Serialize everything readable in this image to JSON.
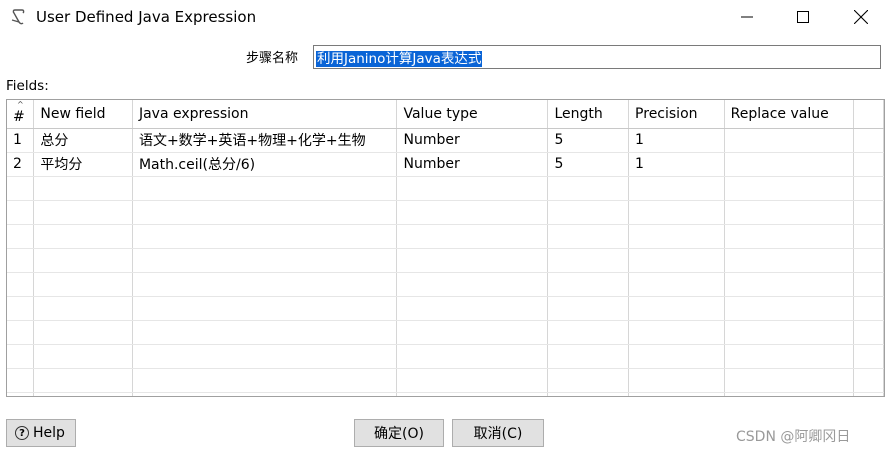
{
  "window": {
    "title": "User Defined Java Expression",
    "minimize_icon": "minimize-icon",
    "maximize_icon": "maximize-icon",
    "close_icon": "close-icon"
  },
  "step": {
    "label": "步骤名称",
    "value": "利用Janino计算Java表达式"
  },
  "fields_label": "Fields:",
  "table": {
    "columns": [
      "#",
      "New field",
      "Java expression",
      "Value type",
      "Length",
      "Precision",
      "Replace value"
    ],
    "rows": [
      [
        "1",
        "总分",
        "语文+数学+英语+物理+化学+生物",
        "Number",
        "5",
        "1",
        ""
      ],
      [
        "2",
        "平均分",
        "Math.ceil(总分/6)",
        "Number",
        "5",
        "1",
        ""
      ]
    ]
  },
  "buttons": {
    "help": "Help",
    "ok": "确定(O)",
    "cancel": "取消(C)"
  },
  "watermark": "CSDN @阿卿冈日"
}
